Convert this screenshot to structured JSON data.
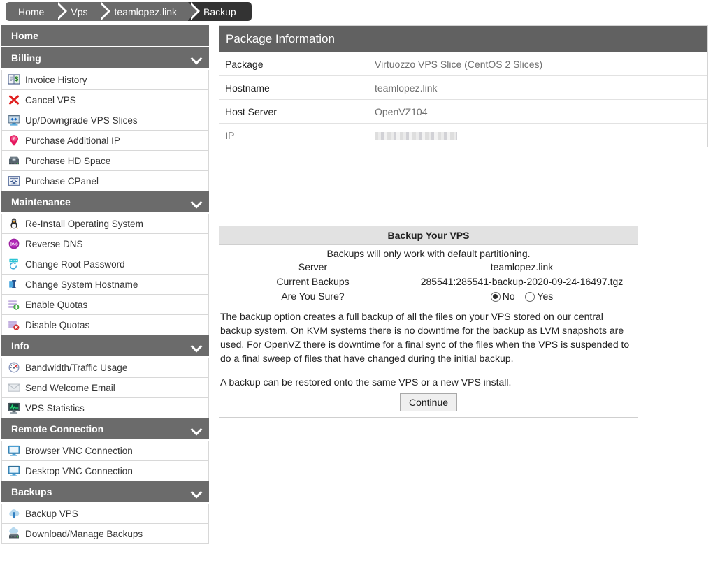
{
  "breadcrumb": [
    {
      "label": "Home",
      "active": false
    },
    {
      "label": "Vps",
      "active": false
    },
    {
      "label": "teamlopez.link",
      "active": false
    },
    {
      "label": "Backup",
      "active": true
    }
  ],
  "sidebar": {
    "sections": [
      {
        "title": "Home",
        "collapsible": false,
        "items": []
      },
      {
        "title": "Billing",
        "collapsible": true,
        "items": [
          {
            "label": "Invoice History",
            "icon": "invoice-icon"
          },
          {
            "label": "Cancel VPS",
            "icon": "red-x-icon"
          },
          {
            "label": "Up/Downgrade VPS Slices",
            "icon": "monitor-arrows-icon"
          },
          {
            "label": "Purchase Additional IP",
            "icon": "ip-pin-icon"
          },
          {
            "label": "Purchase HD Space",
            "icon": "harddisk-icon"
          },
          {
            "label": "Purchase CPanel",
            "icon": "cpanel-icon"
          }
        ]
      },
      {
        "title": "Maintenance",
        "collapsible": true,
        "items": [
          {
            "label": "Re-Install Operating System",
            "icon": "linux-penguin-icon"
          },
          {
            "label": "Reverse DNS",
            "icon": "dns-icon"
          },
          {
            "label": "Change Root Password",
            "icon": "password-refresh-icon"
          },
          {
            "label": "Change System Hostname",
            "icon": "text-cursor-icon"
          },
          {
            "label": "Enable Quotas",
            "icon": "quota-add-icon"
          },
          {
            "label": "Disable Quotas",
            "icon": "quota-remove-icon"
          }
        ]
      },
      {
        "title": "Info",
        "collapsible": true,
        "items": [
          {
            "label": "Bandwidth/Traffic Usage",
            "icon": "gauge-icon"
          },
          {
            "label": "Send Welcome Email",
            "icon": "envelope-icon"
          },
          {
            "label": "VPS Statistics",
            "icon": "monitor-chart-icon"
          }
        ]
      },
      {
        "title": "Remote Connection",
        "collapsible": true,
        "items": [
          {
            "label": "Browser VNC Connection",
            "icon": "monitor-icon"
          },
          {
            "label": "Desktop VNC Connection",
            "icon": "monitor-icon"
          }
        ]
      },
      {
        "title": "Backups",
        "collapsible": true,
        "items": [
          {
            "label": "Backup VPS",
            "icon": "cloud-download-icon"
          },
          {
            "label": "Download/Manage Backups",
            "icon": "cloud-drive-icon"
          }
        ]
      }
    ]
  },
  "package_panel": {
    "title": "Package Information",
    "rows": [
      {
        "label": "Package",
        "value": "Virtuozzo VPS Slice (CentOS 2 Slices)",
        "redacted": false
      },
      {
        "label": "Hostname",
        "value": "teamlopez.link",
        "redacted": false
      },
      {
        "label": "Host Server",
        "value": "OpenVZ104",
        "redacted": false
      },
      {
        "label": "IP",
        "value": "",
        "redacted": true
      }
    ]
  },
  "backup_panel": {
    "title": "Backup Your VPS",
    "note": "Backups will only work with default partitioning.",
    "fields": [
      {
        "label": "Server",
        "value": "teamlopez.link"
      },
      {
        "label": "Current Backups",
        "value": "285541:285541-backup-2020-09-24-16497.tgz"
      }
    ],
    "confirm_label": "Are You Sure?",
    "options": [
      {
        "label": "No",
        "selected": true
      },
      {
        "label": "Yes",
        "selected": false
      }
    ],
    "paragraph1": "The backup option creates a full backup of all the files on your VPS stored on our central backup system. On KVM systems there is no downtime for the backup as LVM snapshots are used. For OpenVZ there is downtime for a final sync of the files when the VPS is suspended to do a final sweep of files that have changed during the initial backup.",
    "paragraph2": "A backup can be restored onto the same VPS or a new VPS install.",
    "continue_label": "Continue"
  },
  "colors": {
    "header_gray": "#616161",
    "sidebar_header": "#6b6b6b",
    "breadcrumb_active": "#333333",
    "panel_head_light": "#e2e2e2",
    "value_text": "#6f6f6f"
  }
}
